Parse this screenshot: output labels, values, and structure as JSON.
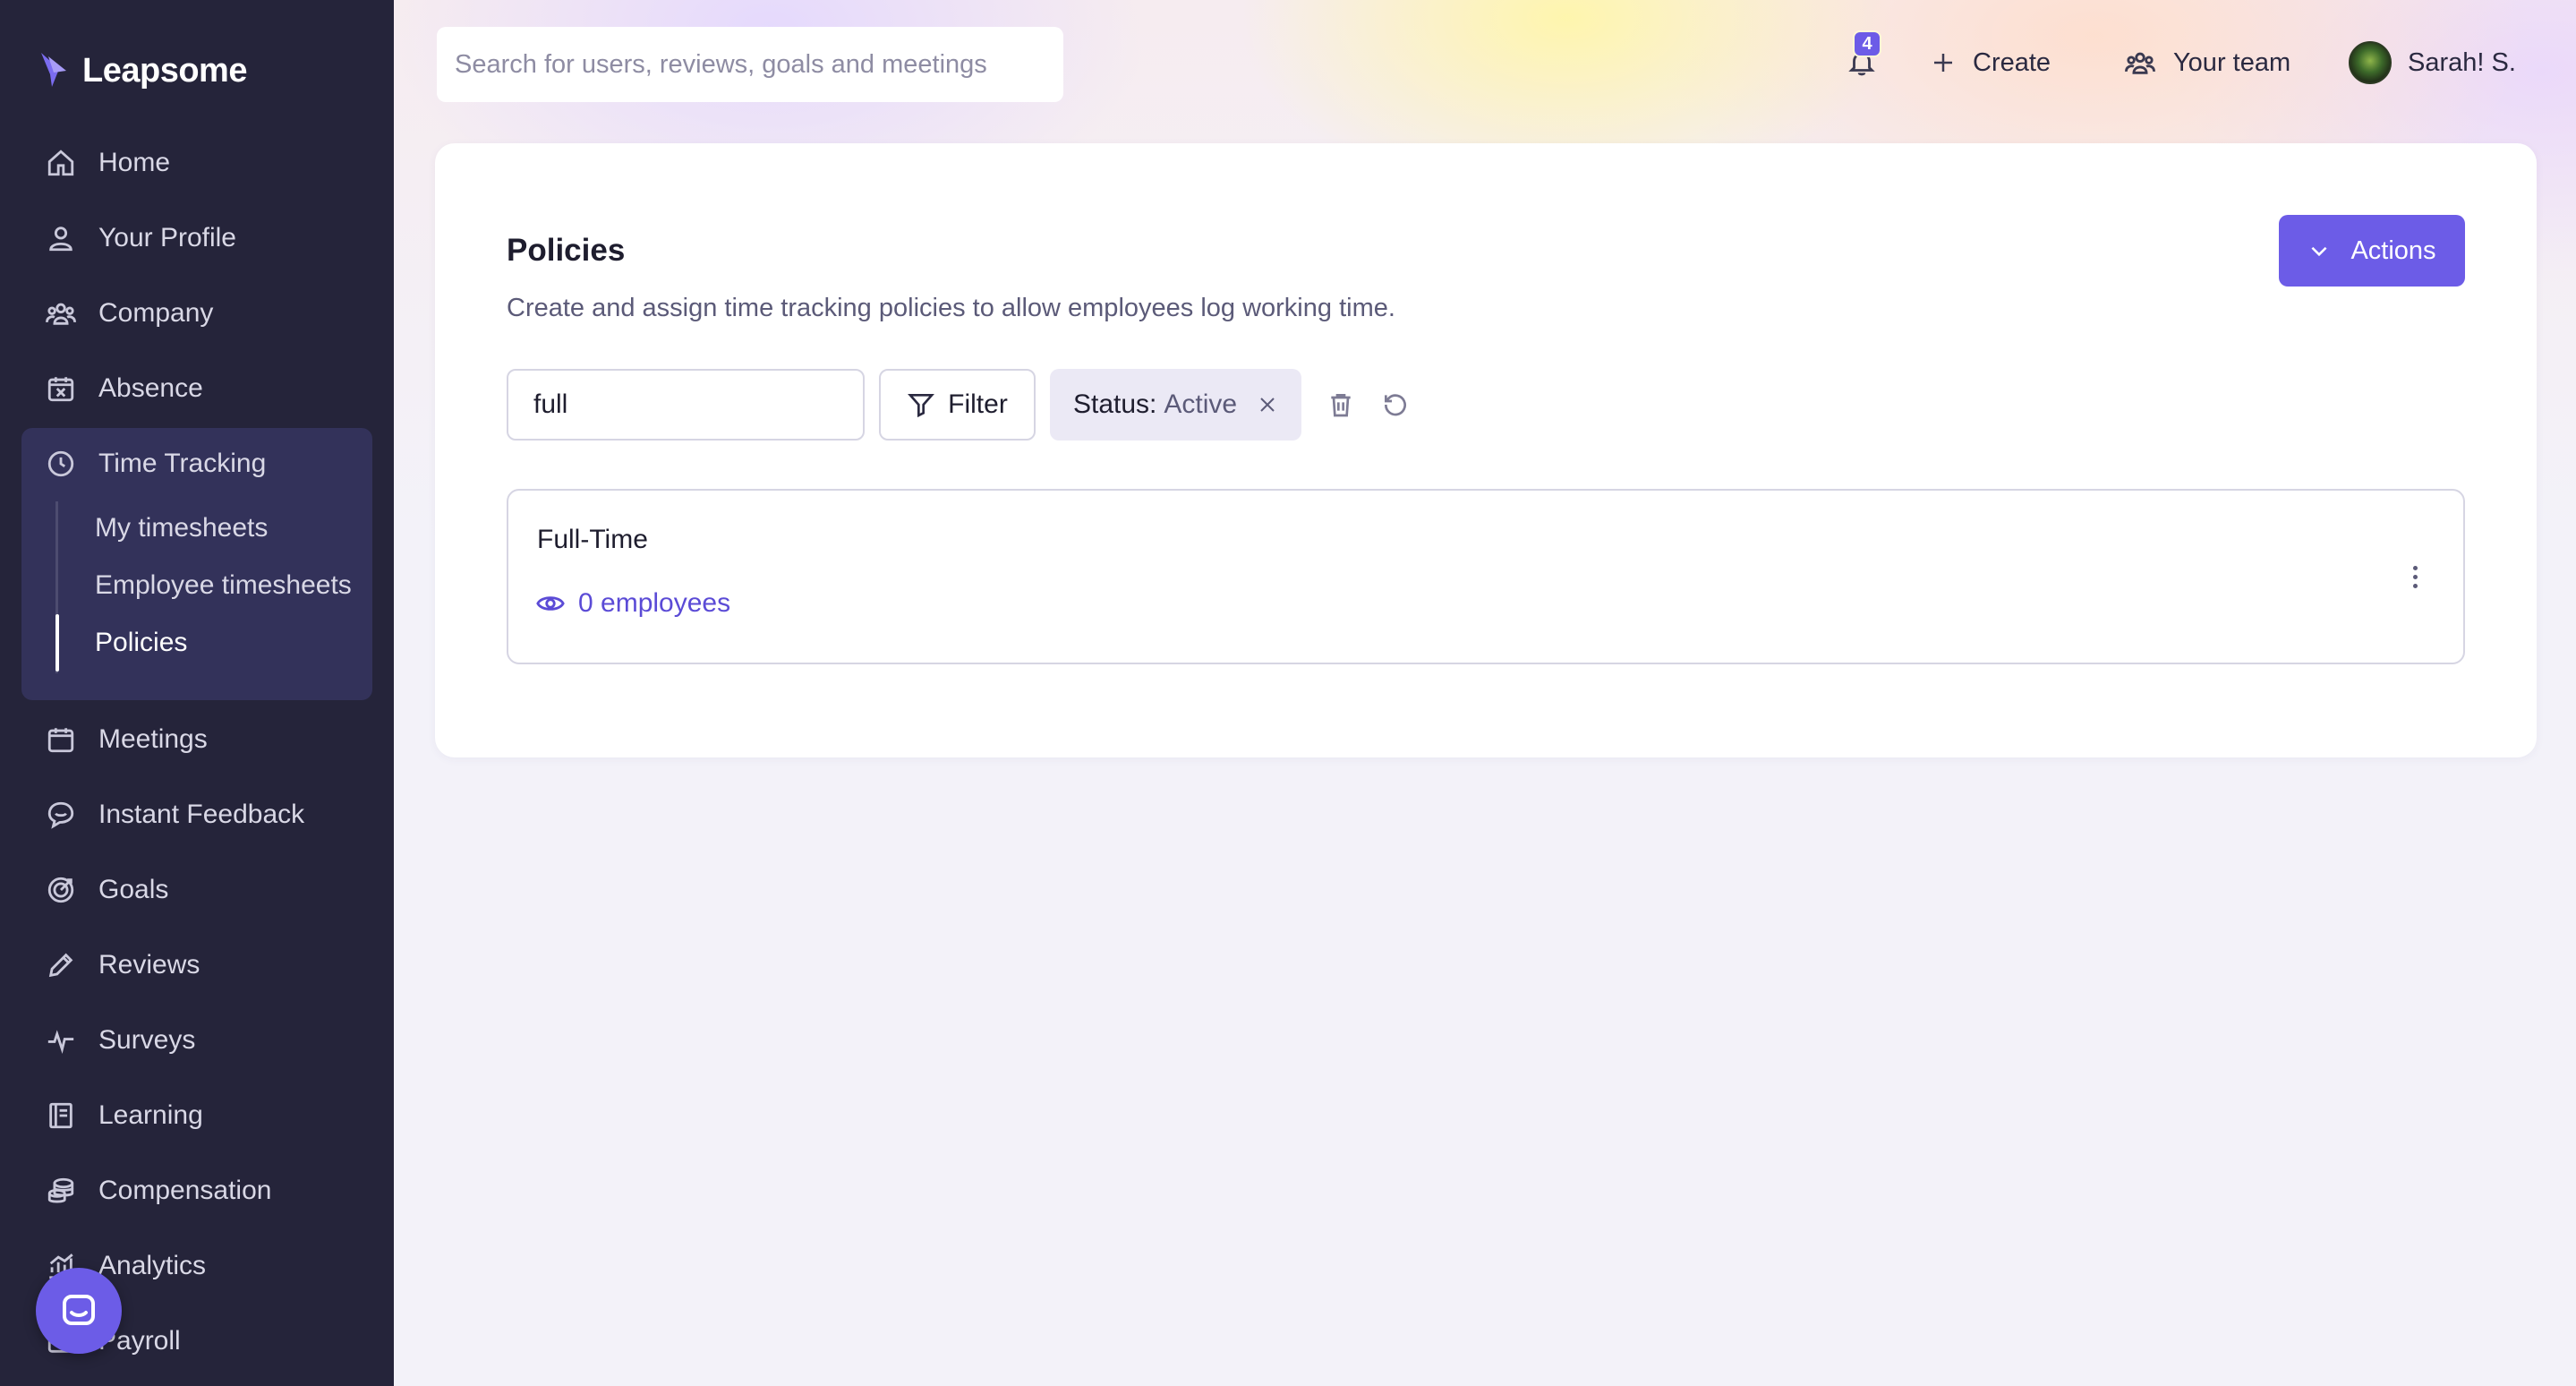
{
  "app": {
    "name": "Leapsome"
  },
  "sidebar": {
    "items": [
      {
        "label": "Home",
        "icon": "home-icon"
      },
      {
        "label": "Your Profile",
        "icon": "user-icon"
      },
      {
        "label": "Company",
        "icon": "people-icon"
      },
      {
        "label": "Absence",
        "icon": "calendar-x-icon"
      },
      {
        "label": "Time Tracking",
        "icon": "clock-icon"
      },
      {
        "label": "Meetings",
        "icon": "calendar-icon"
      },
      {
        "label": "Instant Feedback",
        "icon": "chat-icon"
      },
      {
        "label": "Goals",
        "icon": "target-icon"
      },
      {
        "label": "Reviews",
        "icon": "pencil-icon"
      },
      {
        "label": "Surveys",
        "icon": "pulse-icon"
      },
      {
        "label": "Learning",
        "icon": "book-icon"
      },
      {
        "label": "Compensation",
        "icon": "coins-icon"
      },
      {
        "label": "Analytics",
        "icon": "chart-icon"
      },
      {
        "label": "Payroll",
        "icon": "wallet-icon"
      }
    ],
    "time_tracking_sub": [
      {
        "label": "My timesheets"
      },
      {
        "label": "Employee timesheets"
      },
      {
        "label": "Policies"
      }
    ],
    "active_sub": "Policies"
  },
  "header": {
    "search_placeholder": "Search for users, reviews, goals and meetings",
    "notifications_count": "4",
    "create_label": "Create",
    "team_label": "Your team",
    "user_name": "Sarah! S."
  },
  "main": {
    "title": "Policies",
    "description": "Create and assign time tracking policies to allow employees log working time.",
    "actions_label": "Actions",
    "search_value": "full",
    "filter_label": "Filter",
    "status_chip": {
      "key": "Status:",
      "value": "Active"
    },
    "policies": [
      {
        "name": "Full-Time",
        "employees": "0 employees"
      }
    ]
  },
  "colors": {
    "accent": "#6c5ce7",
    "sidebar_bg": "#25243a",
    "active_group_bg": "#33325a"
  }
}
